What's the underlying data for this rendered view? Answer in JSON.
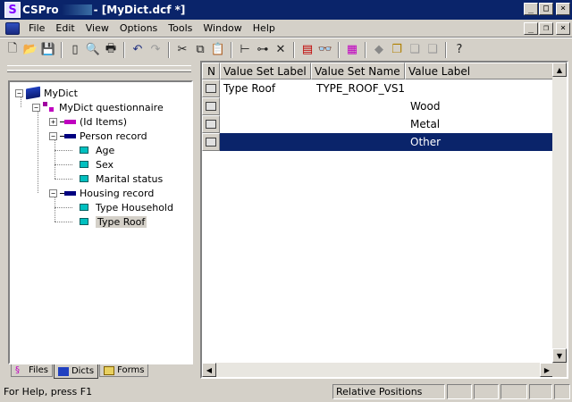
{
  "window": {
    "app_name": "CSPro",
    "document_title": "- [MyDict.dcf *]"
  },
  "menu": [
    "File",
    "Edit",
    "View",
    "Options",
    "Tools",
    "Window",
    "Help"
  ],
  "tree": {
    "root": "MyDict",
    "questionnaire": "MyDict questionnaire",
    "id_items": "(Id Items)",
    "person_record": "Person record",
    "person_items": [
      "Age",
      "Sex",
      "Marital status"
    ],
    "housing_record": "Housing record",
    "housing_items": [
      "Type Household",
      "Type Roof"
    ]
  },
  "tabs": [
    "Files",
    "Dicts",
    "Forms"
  ],
  "grid": {
    "headers": [
      "N",
      "Value Set Label",
      "Value Set Name",
      "Value Label"
    ],
    "rows": [
      {
        "value_set_label": "Type Roof",
        "value_set_name": "TYPE_ROOF_VS1",
        "value_label": ""
      },
      {
        "value_set_label": "",
        "value_set_name": "",
        "value_label": "Wood"
      },
      {
        "value_set_label": "",
        "value_set_name": "",
        "value_label": "Metal"
      },
      {
        "value_set_label": "",
        "value_set_name": "",
        "value_label": "Other"
      }
    ],
    "selected_row_index": 3
  },
  "status": {
    "help": "For Help, press F1",
    "mode": "Relative Positions"
  }
}
